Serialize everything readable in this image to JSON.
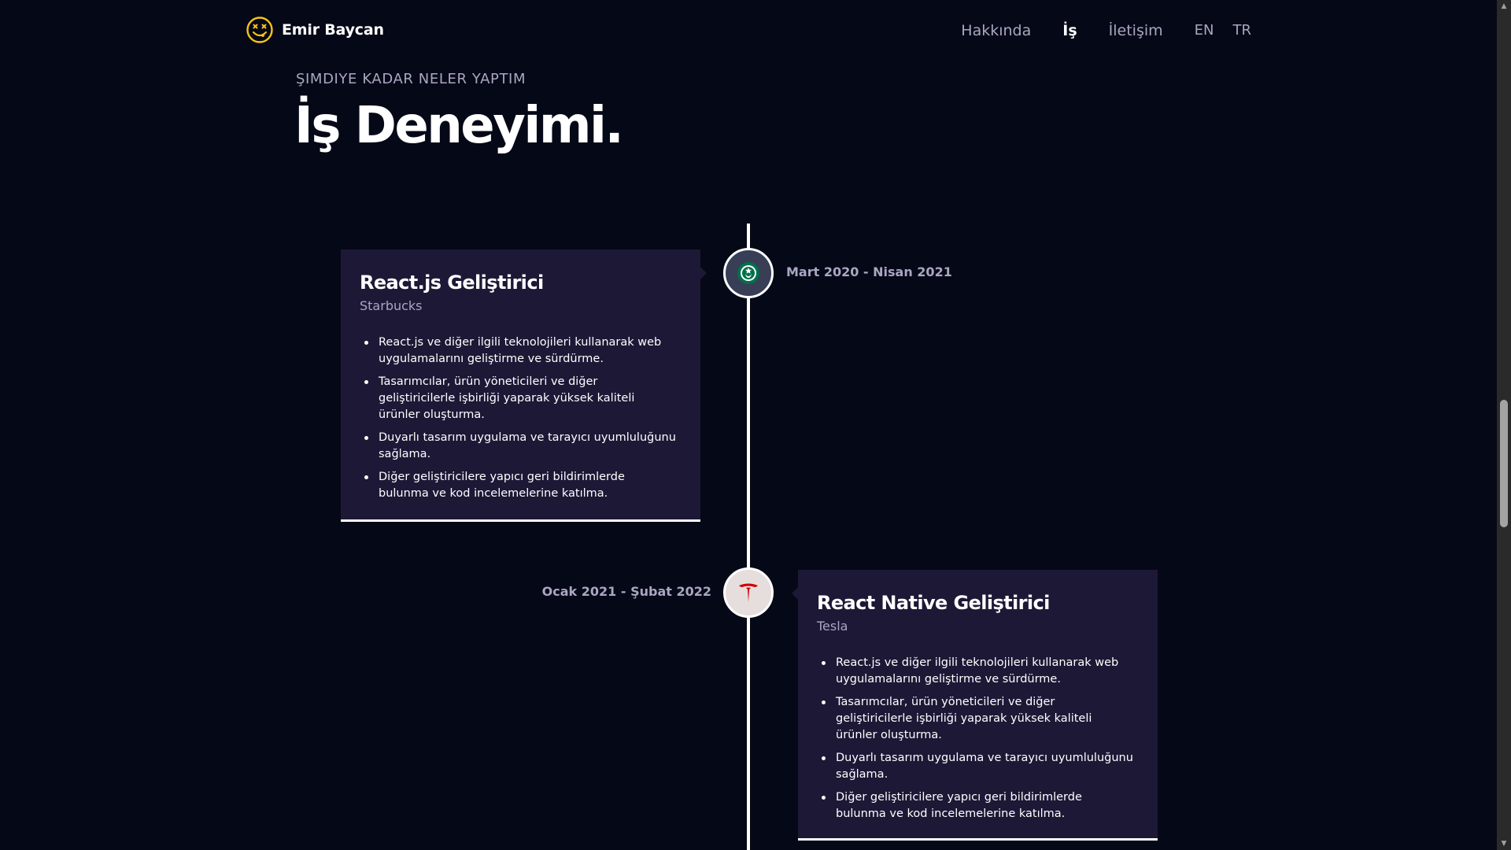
{
  "brand": {
    "name": "Emir Baycan",
    "logo_icon": "smiley-face-icon",
    "logo_color": "#f5c518"
  },
  "nav": {
    "links": [
      "Hakkında",
      "İş",
      "İletişim"
    ],
    "active": "İş",
    "languages": [
      "EN",
      "TR"
    ]
  },
  "section": {
    "subtitle": "ŞIMDIYE KADAR NELER YAPTIM",
    "title": "İş Deneyimi."
  },
  "colors": {
    "background": "#050816",
    "card": "#1d1836",
    "secondary_text": "#aaa6c3",
    "tesla_red": "#cc0000",
    "starbucks_green": "#00704a"
  },
  "experiences": [
    {
      "title": "React.js Geliştirici",
      "company": "Starbucks",
      "date": "Mart 2020 - Nisan 2021",
      "icon": "starbucks-logo-icon",
      "icon_bg": "#383e56",
      "points": [
        "React.js ve diğer ilgili teknolojileri kullanarak web uygulamalarını geliştirme ve sürdürme.",
        "Tasarımcılar, ürün yöneticileri ve diğer geliştiricilerle işbirliği yaparak yüksek kaliteli ürünler oluşturma.",
        "Duyarlı tasarım uygulama ve tarayıcı uyumluluğunu sağlama.",
        "Diğer geliştiricilere yapıcı geri bildirimlerde bulunma ve kod incelemelerine katılma."
      ]
    },
    {
      "title": "React Native Geliştirici",
      "company": "Tesla",
      "date": "Ocak 2021 - Şubat 2022",
      "icon": "tesla-logo-icon",
      "icon_bg": "#e6dedd",
      "points": [
        "React.js ve diğer ilgili teknolojileri kullanarak web uygulamalarını geliştirme ve sürdürme.",
        "Tasarımcılar, ürün yöneticileri ve diğer geliştiricilerle işbirliği yaparak yüksek kaliteli ürünler oluşturma.",
        "Duyarlı tasarım uygulama ve tarayıcı uyumluluğunu sağlama.",
        "Diğer geliştiricilere yapıcı geri bildirimlerde bulunma ve kod incelemelerine katılma."
      ]
    }
  ]
}
